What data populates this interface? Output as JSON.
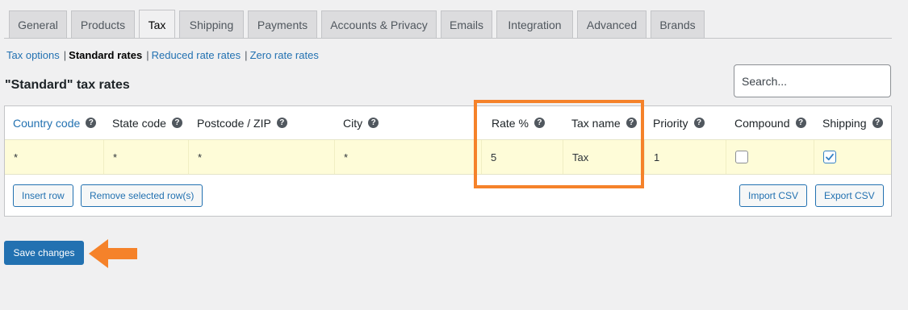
{
  "tabs": [
    {
      "label": "General",
      "active": false
    },
    {
      "label": "Products",
      "active": false
    },
    {
      "label": "Tax",
      "active": true
    },
    {
      "label": "Shipping",
      "active": false
    },
    {
      "label": "Payments",
      "active": false
    },
    {
      "label": "Accounts & Privacy",
      "active": false
    },
    {
      "label": "Emails",
      "active": false
    },
    {
      "label": "Integration",
      "active": false
    },
    {
      "label": "Advanced",
      "active": false
    },
    {
      "label": "Brands",
      "active": false
    }
  ],
  "subnav": {
    "tax_options": "Tax options",
    "standard_rates": "Standard rates",
    "reduced_rate_rates": "Reduced rate rates",
    "zero_rate_rates": "Zero rate rates",
    "separator": "|"
  },
  "heading": "\"Standard\" tax rates",
  "search": {
    "placeholder": "Search...",
    "value": ""
  },
  "table": {
    "columns": {
      "country_code": "Country code",
      "state_code": "State code",
      "postcode": "Postcode / ZIP",
      "city": "City",
      "rate": "Rate %",
      "tax_name": "Tax name",
      "priority": "Priority",
      "compound": "Compound",
      "shipping": "Shipping"
    },
    "help_glyph": "?",
    "row": {
      "country_code": "*",
      "state_code": "*",
      "postcode": "*",
      "city": "*",
      "rate": "5",
      "tax_name": "Tax",
      "priority": "1",
      "compound": false,
      "shipping": true
    },
    "buttons": {
      "insert_row": "Insert row",
      "remove_selected": "Remove selected row(s)",
      "import_csv": "Import CSV",
      "export_csv": "Export CSV"
    }
  },
  "save_button": "Save changes",
  "colors": {
    "accent": "#2271b1",
    "highlight": "#f5822a",
    "row_background": "#fefcd8"
  },
  "icons": {
    "help": "help-icon",
    "arrow": "arrow-left-icon",
    "checkmark": "checkmark-icon"
  }
}
